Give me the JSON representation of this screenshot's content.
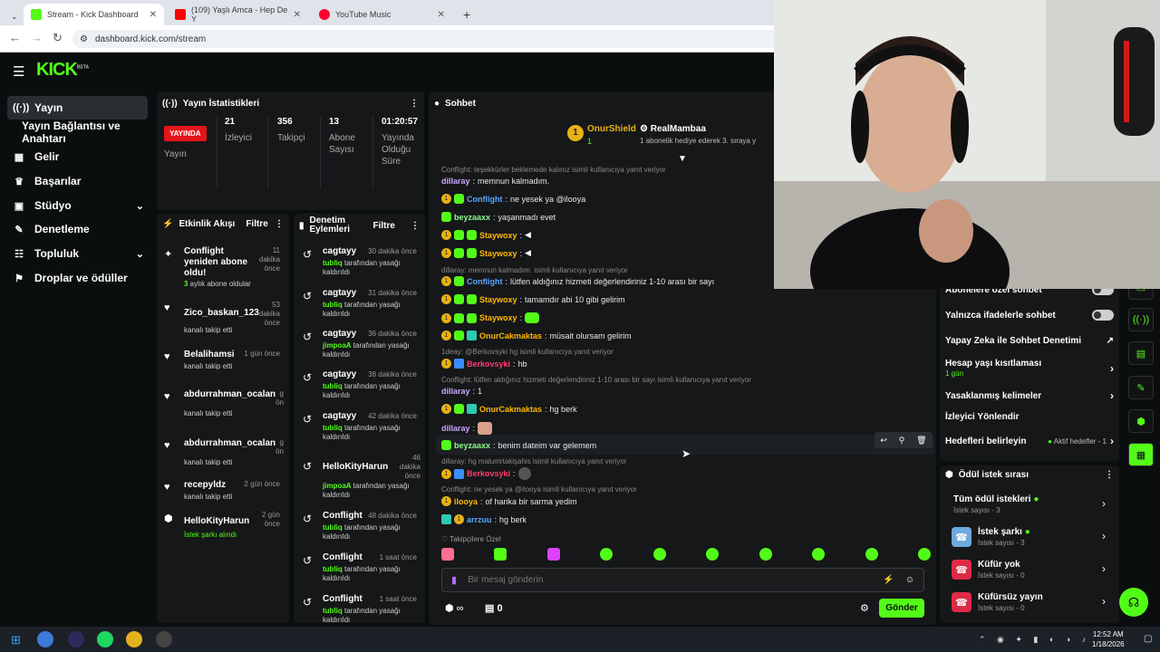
{
  "browser": {
    "tabs": [
      {
        "label": "Stream - Kick Dashboard",
        "active": true,
        "color": "#53fc18"
      },
      {
        "label": "(109) Yaşlı Amca - Hep De Y",
        "active": false,
        "color": "#ff0000"
      },
      {
        "label": "YouTube Music",
        "active": false,
        "color": "#ff0033"
      }
    ],
    "url": "dashboard.kick.com/stream"
  },
  "logo": {
    "text": "KICK",
    "beta": "BETA"
  },
  "sidebar": {
    "items": [
      {
        "label": "Yayın",
        "icon": "broadcast-icon"
      },
      {
        "label": "Yayın Bağlantısı ve Anahtarı",
        "icon": ""
      },
      {
        "label": "Gelir",
        "icon": "chart-icon"
      },
      {
        "label": "Başarılar",
        "icon": "trophy-icon"
      },
      {
        "label": "Stüdyo",
        "icon": "studio-icon"
      },
      {
        "label": "Denetleme",
        "icon": "wrench-icon"
      },
      {
        "label": "Topluluk",
        "icon": "people-icon"
      },
      {
        "label": "Droplar ve ödüller",
        "icon": "gift-icon"
      }
    ]
  },
  "stats": {
    "title": "Yayın İstatistikleri",
    "live": "YAYINDA",
    "live_label": "Yayın",
    "items": [
      {
        "value": "21",
        "label": "İzleyici"
      },
      {
        "value": "356",
        "label": "Takipçi"
      },
      {
        "value": "13",
        "label": "Abone Sayısı"
      },
      {
        "value": "01:20:57",
        "label": "Yayında Olduğu Süre"
      }
    ]
  },
  "activity": {
    "title": "Etkinlik Akışı",
    "filter": "Filtre",
    "rows": [
      {
        "name": "Conflight yeniden abone oldu!",
        "time": "11 dakika önce",
        "sub": "3 aylık abone oldular"
      },
      {
        "name": "Zico_baskan_123",
        "time": "53 dakika önce",
        "sub": "kanalı takip etti"
      },
      {
        "name": "Belalihamsi",
        "time": "1 gün önce",
        "sub": "kanalı takip etti"
      },
      {
        "name": "abdurrahman_ocalan",
        "time": "g ön",
        "sub": "kanalı takip etti"
      },
      {
        "name": "abdurrahman_ocalan",
        "time": "g ön",
        "sub": "kanalı takip etti"
      },
      {
        "name": "recepyldz",
        "time": "2 gün önce",
        "sub": "kanalı takip etti"
      },
      {
        "name": "HelloKityHarun",
        "time": "2 gün önce",
        "sub": "İstek şarkı alındı"
      }
    ]
  },
  "moderation": {
    "title": "Denetim Eylemleri",
    "filter": "Filtre",
    "rows": [
      {
        "name": "cagtayy",
        "time": "30 dakika önce",
        "by": "tubliq",
        "rest": "tarafından yasağı kaldırıldı"
      },
      {
        "name": "cagtayy",
        "time": "31 dakika önce",
        "by": "tubliq",
        "rest": "tarafından yasağı kaldırıldı"
      },
      {
        "name": "cagtayy",
        "time": "36 dakika önce",
        "by": "jimpoaA",
        "rest": "tarafından yasağı kaldırıldı"
      },
      {
        "name": "cagtayy",
        "time": "38 dakika önce",
        "by": "tubliq",
        "rest": "tarafından yasağı kaldırıldı"
      },
      {
        "name": "cagtayy",
        "time": "42 dakika önce",
        "by": "tubliq",
        "rest": "tarafından yasağı kaldırıldı"
      },
      {
        "name": "HelloKityHarun",
        "time": "46 dakika önce",
        "by": "jimpoaA",
        "rest": "tarafından yasağı kaldırıldı"
      },
      {
        "name": "Conflight",
        "time": "48 dakika önce",
        "by": "tubliq",
        "rest": "tarafından yasağı kaldırıldı"
      },
      {
        "name": "Conflight",
        "time": "1 saat önce",
        "by": "tubliq",
        "rest": "tarafından yasağı kaldırıldı"
      },
      {
        "name": "Conflight",
        "time": "1 saat önce",
        "by": "tubliq",
        "rest": "tarafından yasağı kaldırıldı"
      }
    ]
  },
  "chat": {
    "title": "Sohbet",
    "pinned": {
      "user1": "OnurShield",
      "user1_count": "1",
      "user2": "RealMambaa",
      "user2_note": "1 abonelik hediye ederek 3. sıraya y"
    },
    "lines": [
      {
        "kind": "reply",
        "text": "Conflight: teşekkürler beklemede kalınız isimli kullanıcıya yanıt veriyor"
      },
      {
        "kind": "msg",
        "user": "dillaray",
        "color": "#c9a6ff",
        "text": "memnun kalmadım."
      },
      {
        "kind": "msg",
        "user": "Conflight",
        "color": "#5aa8ff",
        "text": "ne yesek ya @ilooya",
        "badges": "bg"
      },
      {
        "kind": "msg",
        "user": "beyzaaxx",
        "color": "#8dfc8d",
        "text": "yaşanmadı evet",
        "badges": "g"
      },
      {
        "kind": "msg",
        "user": "Staywoxy",
        "color": "#ffb800",
        "text": "",
        "badges": "bgg",
        "emote": true
      },
      {
        "kind": "msg",
        "user": "Staywoxy",
        "color": "#ffb800",
        "text": "",
        "badges": "bgg",
        "emote": true
      },
      {
        "kind": "reply",
        "text": "dillaray: memnun kalmadım. isimli kullanıcıya yanıt veriyor"
      },
      {
        "kind": "msg",
        "user": "Conflight",
        "color": "#5aa8ff",
        "text": "lütfen aldığınız hizmeti değerlendiriniz 1-10 arası bir sayı",
        "badges": "bg"
      },
      {
        "kind": "msg",
        "user": "Staywoxy",
        "color": "#ffb800",
        "text": "tamamdır abi 10 gibi gelirim",
        "badges": "bgg"
      },
      {
        "kind": "msg",
        "user": "Staywoxy",
        "color": "#ffb800",
        "text": "",
        "badges": "bgg",
        "emote": true
      },
      {
        "kind": "msg",
        "user": "OnurCakmaktas",
        "color": "#ffb800",
        "text": "müsait olursam gelirim",
        "badges": "bgt"
      },
      {
        "kind": "reply",
        "text": "1deay: @Berkovsyki hg isimli kullanıcıya yanıt veriyor"
      },
      {
        "kind": "msg",
        "user": "Berkovsyki",
        "color": "#ff3d6e",
        "text": "hb",
        "badges": "bt"
      },
      {
        "kind": "reply",
        "text": "Conflight: lütfen aldığınız hizmeti değerlendiriniz 1-10 arası bir sayı isimli kullanıcıya yanıt veriyor"
      },
      {
        "kind": "msg",
        "user": "dillaray",
        "color": "#c9a6ff",
        "text": "1"
      },
      {
        "kind": "msg",
        "user": "OnurCakmaktas",
        "color": "#ffb800",
        "text": "hg berk",
        "badges": "bgt"
      },
      {
        "kind": "msg",
        "user": "dillaray",
        "color": "#c9a6ff",
        "text": "",
        "emote": true
      },
      {
        "kind": "msg",
        "user": "beyzaaxx",
        "color": "#8dfc8d",
        "text": "benim dateim var gelemem",
        "badges": "g"
      },
      {
        "kind": "reply",
        "text": "dillaray: hg malumrtakişahis isimli kullanıcıya yanıt veriyor"
      },
      {
        "kind": "msg",
        "user": "Berkovsyki",
        "color": "#ff3d6e",
        "text": "",
        "badges": "bt",
        "emote": true
      },
      {
        "kind": "reply",
        "text": "Conflight: ne yesek ya @ilooya isimli kullanıcıya yanıt veriyor"
      },
      {
        "kind": "msg",
        "user": "ilooya",
        "color": "#ffb800",
        "text": "of harika bir sarma yedim",
        "badges": "b"
      },
      {
        "kind": "msg",
        "user": "arrzuu",
        "color": "#5aa8ff",
        "text": "hg berk",
        "badges": "tb"
      }
    ],
    "followers_only": "Takipçilere Özel",
    "input_placeholder": "Bir mesaj gönderin",
    "points": "0",
    "send": "Gönder"
  },
  "settings": {
    "rows": [
      {
        "label": "Abonelere özel sohbet",
        "type": "toggle"
      },
      {
        "label": "Yalnızca ifadelerle sohbet",
        "type": "toggle"
      },
      {
        "label": "Yapay Zeka ile Sohbet Denetimi",
        "type": "link"
      },
      {
        "label": "Hesap yaşı kısıtlaması",
        "sub": "1 gün",
        "type": "chev"
      },
      {
        "label": "Yasaklanmış kelimeler",
        "type": "chev"
      },
      {
        "label": "İzleyici Yönlendir",
        "type": "none"
      },
      {
        "label": "Hedefleri belirleyin",
        "extra": "Aktif hedefler - 1",
        "type": "chev"
      }
    ]
  },
  "rewards": {
    "title": "Ödül istek sırası",
    "rows": [
      {
        "label": "Tüm ödül istekleri",
        "count": "İstek sayısı - 3",
        "dot": true,
        "box": ""
      },
      {
        "label": "İstek şarkı",
        "count": "İstek sayısı - 3",
        "dot": true,
        "box": "#6fa8dc"
      },
      {
        "label": "Küfür yok",
        "count": "İstek sayısı - 0",
        "dot": false,
        "box": "#e02a45"
      },
      {
        "label": "Küfürsüz yayın",
        "count": "İstek sayısı - 0",
        "dot": false,
        "box": "#e02a45"
      }
    ]
  },
  "taskbar": {
    "time": "12:52 AM",
    "date": "1/18/2026"
  },
  "colors": {
    "accent": "#53fc18",
    "live": "#e5151a"
  }
}
